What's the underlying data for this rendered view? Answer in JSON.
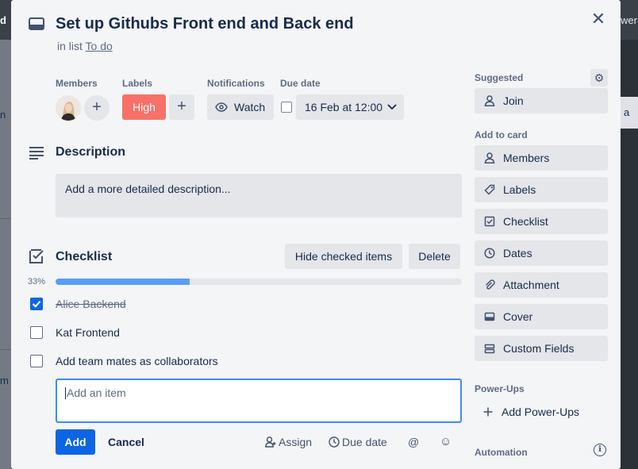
{
  "background": {
    "left_top_label": "d",
    "left_snippets": [
      "n",
      "m"
    ],
    "right_top_label": "wer-",
    "right_chip_label": "a"
  },
  "card": {
    "title": "Set up Githubs Front end and Back end",
    "in_list_prefix": "in list",
    "list_name": "To do"
  },
  "fields": {
    "members_label": "Members",
    "labels_label": "Labels",
    "label_high": "High",
    "notifications_label": "Notifications",
    "watch_label": "Watch",
    "due_date_label": "Due date",
    "due_date_value": "16 Feb at 12:00"
  },
  "description": {
    "title": "Description",
    "placeholder": "Add a more detailed description..."
  },
  "checklist": {
    "title": "Checklist",
    "hide_checked_label": "Hide checked items",
    "delete_label": "Delete",
    "progress_text": "33%",
    "progress": 0.33,
    "items": [
      {
        "text": "Alice Backend",
        "checked": true
      },
      {
        "text": "Kat Frontend",
        "checked": false
      },
      {
        "text": "Add team mates as collaborators",
        "checked": false
      }
    ],
    "add_item_placeholder": "Add an item",
    "add_label": "Add",
    "cancel_label": "Cancel",
    "assign_label": "Assign",
    "due_date_label": "Due date",
    "mention_symbol": "@",
    "emoji_symbol": "☺"
  },
  "sidebar": {
    "suggested_label": "Suggested",
    "join_label": "Join",
    "add_to_card_label": "Add to card",
    "add_to_card": [
      {
        "label": "Members",
        "icon": "person-icon"
      },
      {
        "label": "Labels",
        "icon": "tag-icon"
      },
      {
        "label": "Checklist",
        "icon": "checklist-icon"
      },
      {
        "label": "Dates",
        "icon": "clock-icon"
      },
      {
        "label": "Attachment",
        "icon": "paperclip-icon"
      },
      {
        "label": "Cover",
        "icon": "cover-icon"
      },
      {
        "label": "Custom Fields",
        "icon": "custom-fields-icon"
      }
    ],
    "power_ups_label": "Power-Ups",
    "add_power_ups_label": "Add Power-Ups",
    "automation_label": "Automation"
  },
  "colors": {
    "label_high": "#f87168",
    "primary": "#0c66e4",
    "progress": "#579dff"
  }
}
